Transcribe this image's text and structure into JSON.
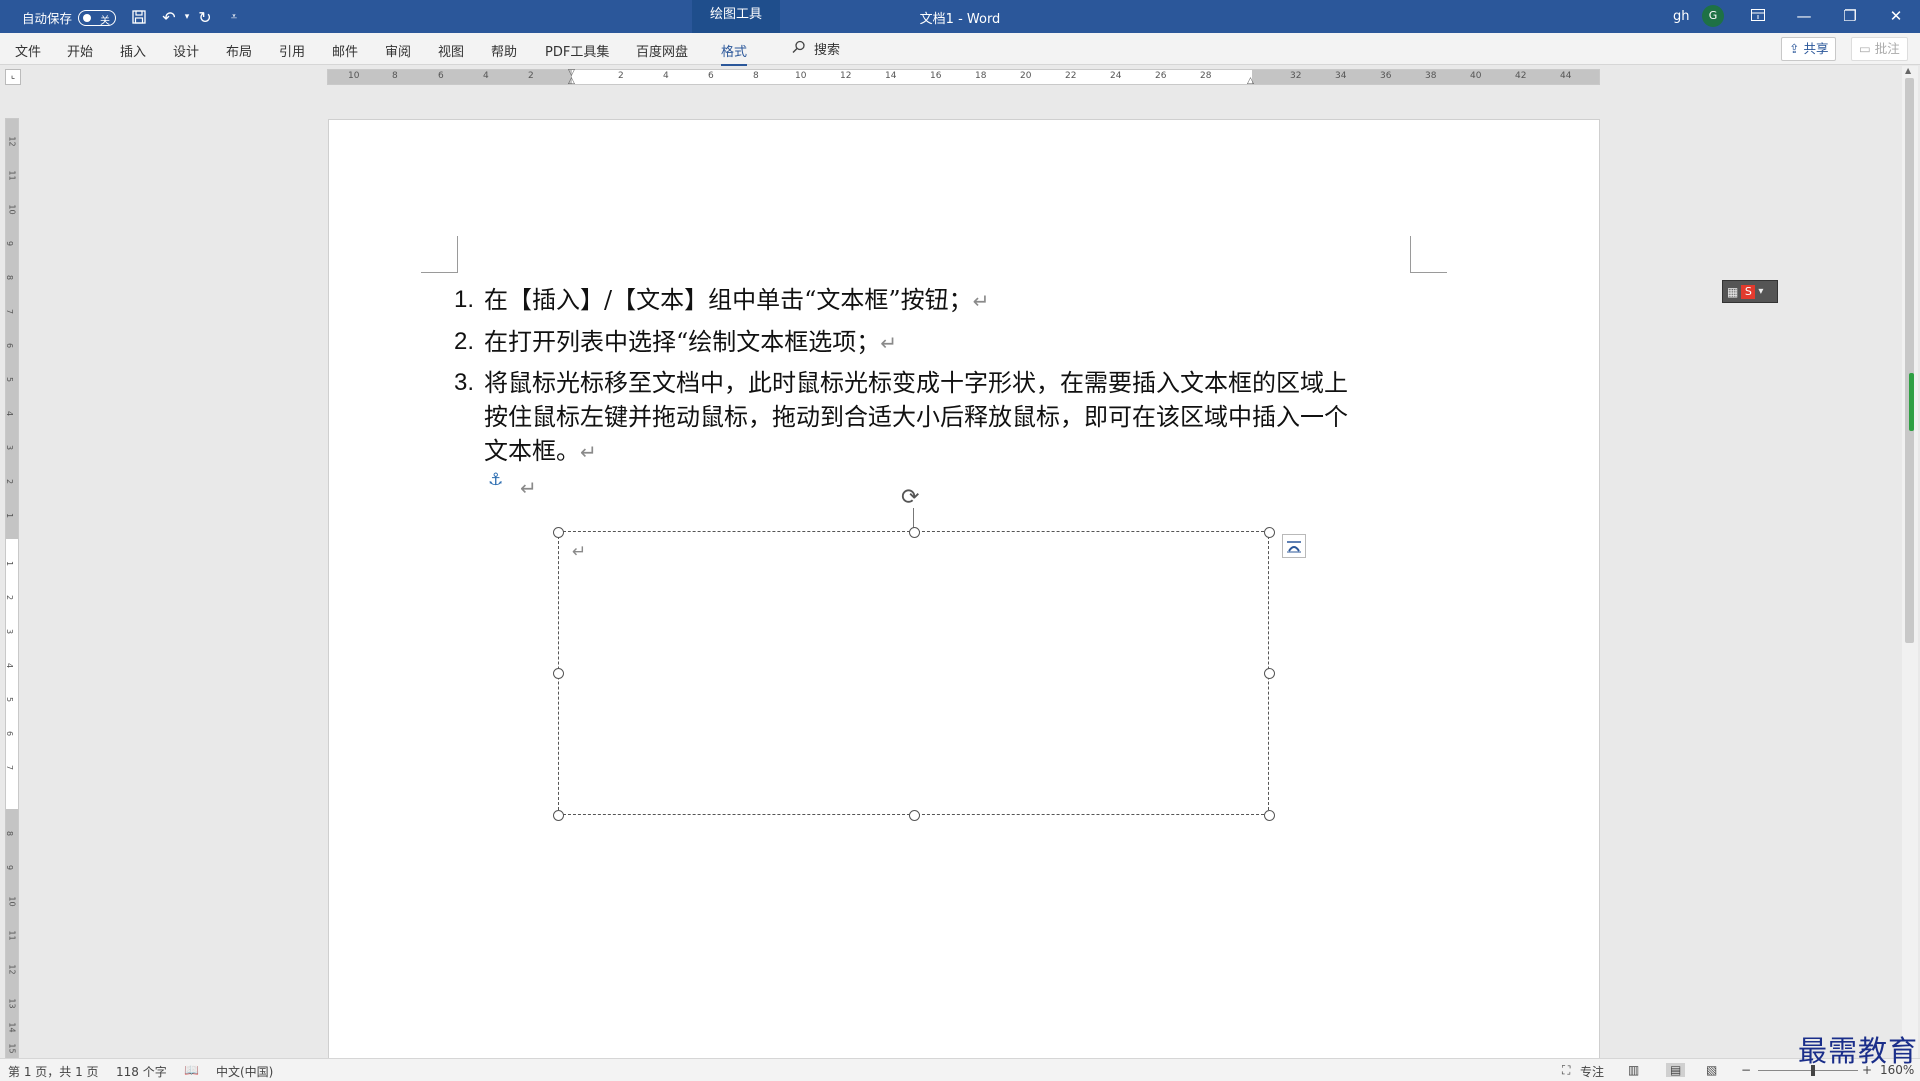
{
  "titlebar": {
    "autosave_label": "自动保存",
    "autosave_state": "关",
    "context_group": "绘图工具",
    "document_title": "文档1  -  Word",
    "user_name": "gh",
    "avatar_initial": "G",
    "icons": [
      "save-icon",
      "undo-icon",
      "redo-icon",
      "customize-icon",
      "ribbon-display-icon",
      "minimize-icon",
      "restore-icon",
      "close-icon"
    ]
  },
  "ribbon": {
    "tabs": [
      "文件",
      "开始",
      "插入",
      "设计",
      "布局",
      "引用",
      "邮件",
      "审阅",
      "视图",
      "帮助",
      "PDF工具集",
      "百度网盘",
      "格式"
    ],
    "search_label": "搜索",
    "share_label": "共享",
    "comment_label": "批注"
  },
  "ruler": {
    "h_numbers": [
      "10",
      "8",
      "6",
      "4",
      "2",
      "2",
      "4",
      "6",
      "8",
      "10",
      "12",
      "14",
      "16",
      "18",
      "20",
      "22",
      "24",
      "26",
      "28",
      "32",
      "34",
      "36",
      "38",
      "40",
      "42",
      "44"
    ],
    "v_numbers": [
      "12",
      "11",
      "10",
      "9",
      "8",
      "7",
      "6",
      "5",
      "4",
      "3",
      "2",
      "1",
      "1",
      "2",
      "3",
      "4",
      "5",
      "6",
      "7",
      "8",
      "9",
      "10",
      "11",
      "12",
      "13",
      "14",
      "15"
    ]
  },
  "document": {
    "items": [
      {
        "number": "1.",
        "text": "在【插入】/【文本】组中单击“文本框”按钮；"
      },
      {
        "number": "2.",
        "text": "在打开列表中选择“绘制文本框选项；"
      },
      {
        "number": "3.",
        "text": "将鼠标光标移至文档中，此时鼠标光标变成十字形状，在需要插入文本框的区域上按住鼠标左键并拖动鼠标，拖动到合适大小后释放鼠标，即可在该区域中插入一个文本框。"
      }
    ],
    "paragraph_mark": "↵",
    "anchor_icon": "anchor-icon"
  },
  "statusbar": {
    "page_info": "第 1 页，共 1 页",
    "word_count": "118 个字",
    "language": "中文(中国)",
    "focus_label": "专注",
    "zoom_level": "160%"
  },
  "watermark": "最需教育"
}
